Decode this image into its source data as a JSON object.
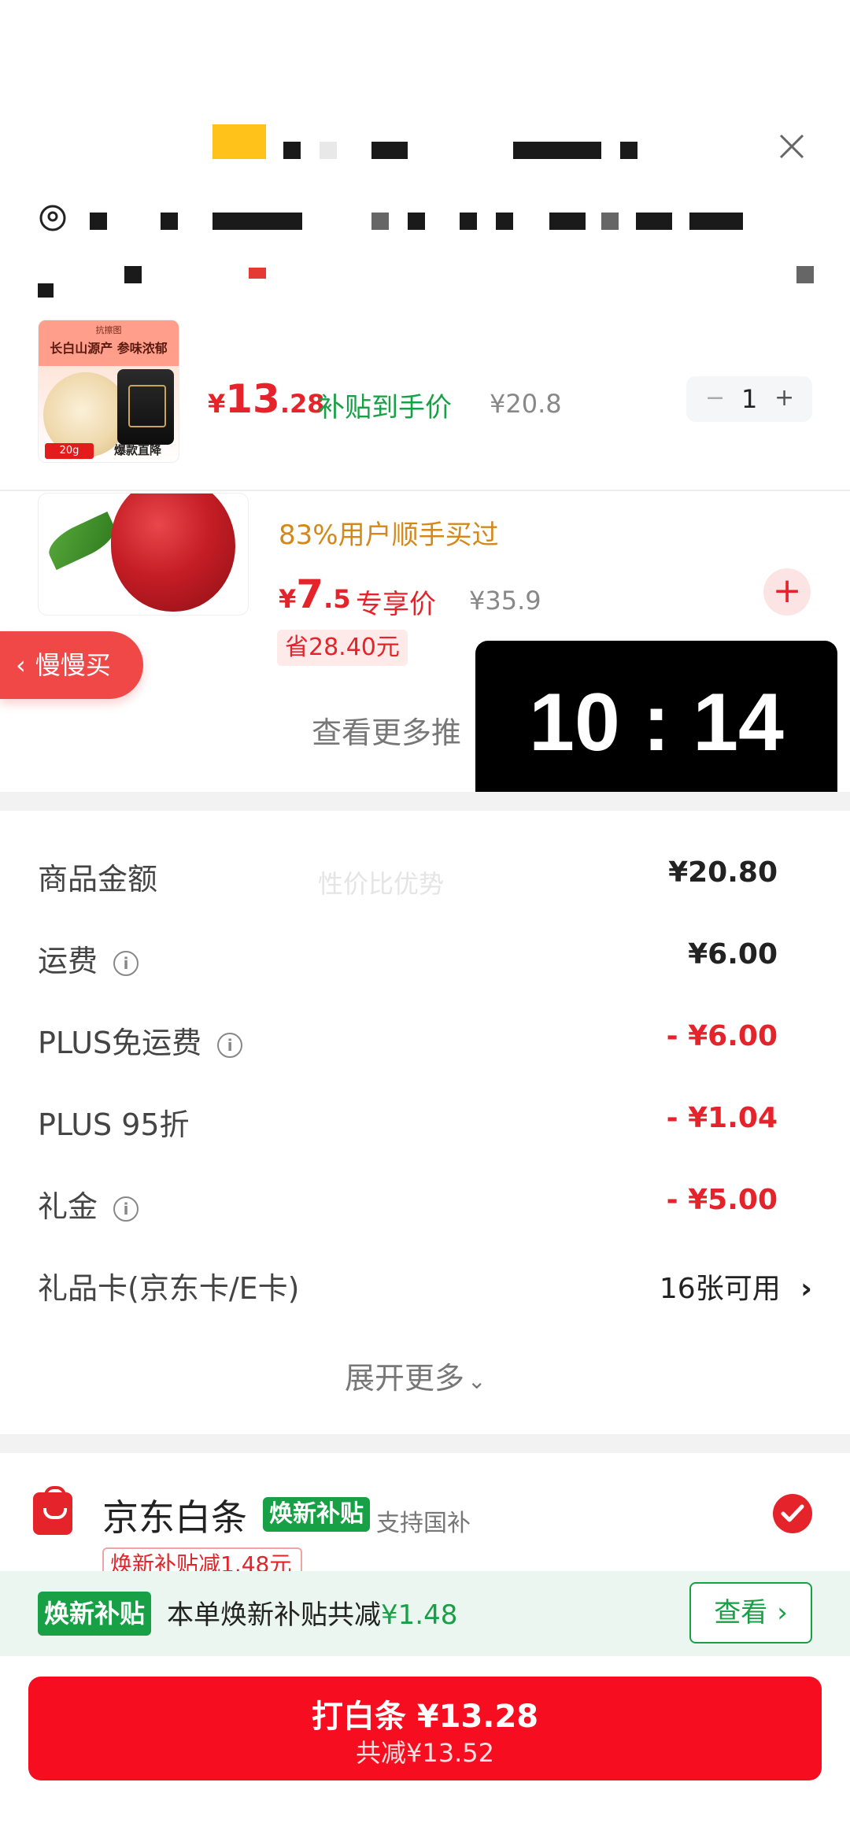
{
  "product_main": {
    "thumb_brand": "抗擦图",
    "thumb_banner": "长白山源产 参味浓郁",
    "thumb_badge": "20g",
    "thumb_badge2": "爆款直降",
    "price_symbol": "¥",
    "price_int": "13",
    "price_dec": ".28",
    "price_note": "补贴到手价",
    "original_price": "¥20.8",
    "qty_minus": "−",
    "qty": "1",
    "qty_plus": "+"
  },
  "product_rec": {
    "bought_note": "83%用户顺手买过",
    "price_symbol": "¥",
    "price_int": "7",
    "price_dec": ".5",
    "price_note": "专享价",
    "original_price": "¥35.9",
    "save_tag": "省28.40元",
    "add_label": "+"
  },
  "slow_buy": {
    "chevron": "‹",
    "label": "慢慢买"
  },
  "timer": {
    "text": "10 : 14"
  },
  "more_rec": {
    "label": "查看更多推"
  },
  "summary": {
    "watermark": "性价比优势",
    "rows": [
      {
        "label": "商品金额",
        "value": "¥20.80"
      },
      {
        "label": "运费",
        "value": "¥6.00",
        "info": "i"
      },
      {
        "label": "PLUS免运费",
        "value": "- ¥6.00",
        "info": "i"
      },
      {
        "label": "PLUS 95折",
        "value": "- ¥1.04"
      },
      {
        "label": "礼金",
        "value": "- ¥5.00",
        "info": "i"
      },
      {
        "label": "礼品卡(京东卡/E卡)",
        "value": "16张可用",
        "chevron": "›"
      }
    ],
    "expand_label": "展开更多",
    "expand_chevron": "⌄"
  },
  "payment": {
    "title": "京东白条",
    "tag": "焕新补贴",
    "support": "支持国补",
    "cut_tag": "焕新补贴减1.48元"
  },
  "subsidy_bar": {
    "tag": "焕新补贴",
    "text_prefix": "本单焕新补贴共减",
    "text_amount": "¥1.48",
    "view_label": "查看",
    "view_chevron": "›"
  },
  "pay_button": {
    "main": "打白条 ¥13.28",
    "sub": "共减¥13.52"
  },
  "colors": {
    "accent_red": "#e4232a",
    "subsidy_green": "#17a045",
    "pay_red": "#f60d1f"
  }
}
